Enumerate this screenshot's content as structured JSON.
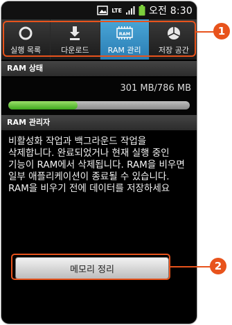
{
  "status_bar": {
    "signal_label": "LTE",
    "time": "오전 8:30",
    "icons": [
      "gallery-icon",
      "lte-icon",
      "signal-bars-icon",
      "battery-icon"
    ]
  },
  "tabs": [
    {
      "label": "실행 목록",
      "icon": "circle-icon",
      "active": false
    },
    {
      "label": "다운로드",
      "icon": "download-icon",
      "active": false
    },
    {
      "label": "RAM 관리",
      "icon": "ram-chip-icon",
      "icon_text": "RAM",
      "active": true
    },
    {
      "label": "저장 공간",
      "icon": "pie-chart-icon",
      "active": false
    }
  ],
  "ram_status": {
    "header": "RAM 상태",
    "usage_text": "301 MB/786 MB",
    "used_fraction": 0.383
  },
  "ram_manager": {
    "header": "RAM 관리자",
    "description": "비활성화 작업과 백그라운드 작업을 삭제합니다. 완료되었거나 현재 실행 중인 기능이 RAM에서 삭제됩니다. RAM을 비우면 일부 애플리케이션이 종료될 수 있습니다. RAM을 비우기 전에 데이터를 저장하세요",
    "button_label": "메모리 정리"
  },
  "callouts": [
    {
      "number": "1"
    },
    {
      "number": "2"
    }
  ],
  "colors": {
    "accent": "#e8531c",
    "active_tab": "#3a92c6",
    "progress_fill": "#5cc02e"
  }
}
